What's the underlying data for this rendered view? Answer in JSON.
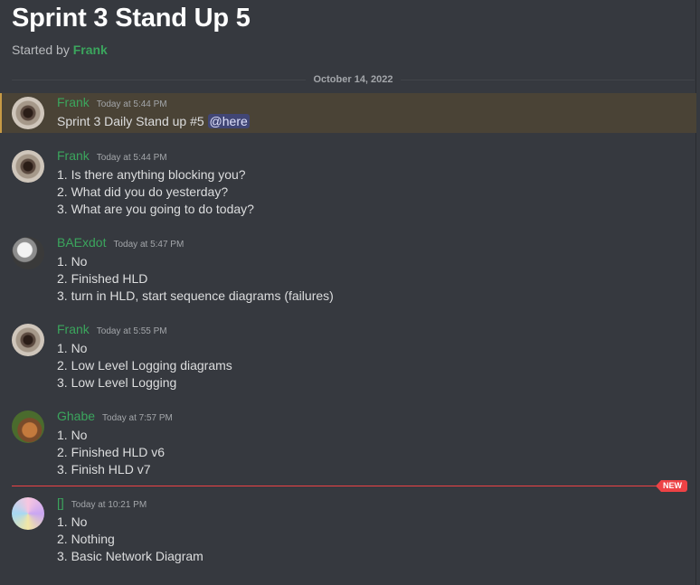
{
  "thread": {
    "title": "Sprint 3 Stand Up 5",
    "started_by_prefix": "Started by ",
    "started_by_user": "Frank"
  },
  "date_divider": "October 14, 2022",
  "new_badge": "NEW",
  "messages": [
    {
      "user": "Frank",
      "time": "Today at 5:44 PM",
      "avatar": "eye-avatar",
      "highlighted": true,
      "lines": [
        "Sprint 3 Daily Stand up #5 "
      ],
      "mention": "@here"
    },
    {
      "user": "Frank",
      "time": "Today at 5:44 PM",
      "avatar": "eye-avatar",
      "lines": [
        "1. Is there anything blocking you?",
        "2. What did you do yesterday?",
        "3. What are you going to do today?"
      ]
    },
    {
      "user": "BAExdot",
      "time": "Today at 5:47 PM",
      "avatar": "bw-avatar",
      "lines": [
        "1. No",
        "2. Finished HLD",
        "3. turn in HLD, start sequence diagrams (failures)"
      ]
    },
    {
      "user": "Frank",
      "time": "Today at 5:55 PM",
      "avatar": "eye-avatar",
      "lines": [
        "1. No",
        "2. Low Level Logging diagrams",
        "3. Low Level Logging"
      ]
    },
    {
      "user": "Ghabe",
      "time": "Today at 7:57 PM",
      "avatar": "dog-avatar",
      "lines": [
        "1. No",
        "2. Finished HLD v6",
        "3. Finish HLD v7"
      ]
    },
    {
      "user": "[]",
      "time": "Today at 10:21 PM",
      "avatar": "art-avatar",
      "lines": [
        "1. No",
        "2. Nothing",
        "3. Basic Network Diagram"
      ]
    }
  ]
}
